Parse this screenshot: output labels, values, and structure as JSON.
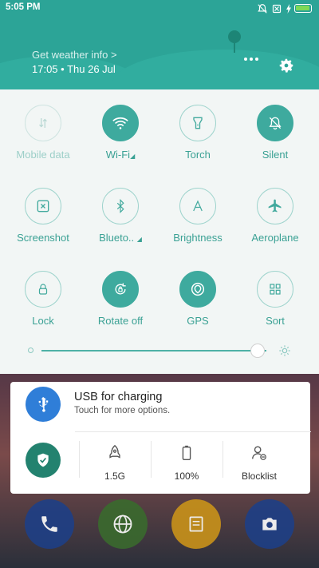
{
  "status_bar": {
    "time": "5:05 PM"
  },
  "header": {
    "weather_link": "Get weather info >",
    "datetime": "17:05 • Thu 26 Jul",
    "more_icon": "more-icon",
    "settings_icon": "gear-icon"
  },
  "tiles": [
    {
      "label": "Mobile data",
      "icon": "mobile-data-icon",
      "state": "off"
    },
    {
      "label": "Wi-Fi",
      "icon": "wifi-icon",
      "state": "on"
    },
    {
      "label": "Torch",
      "icon": "torch-icon",
      "state": "idle"
    },
    {
      "label": "Silent",
      "icon": "silent-bell-icon",
      "state": "on"
    },
    {
      "label": "Screenshot",
      "icon": "screenshot-icon",
      "state": "idle"
    },
    {
      "label": "Blueto..",
      "icon": "bluetooth-icon",
      "state": "idle"
    },
    {
      "label": "Brightness",
      "icon": "brightness-a-icon",
      "state": "idle"
    },
    {
      "label": "Aeroplane",
      "icon": "aeroplane-icon",
      "state": "idle"
    },
    {
      "label": "Lock",
      "icon": "lock-icon",
      "state": "idle"
    },
    {
      "label": "Rotate off",
      "icon": "rotate-lock-icon",
      "state": "on"
    },
    {
      "label": "GPS",
      "icon": "gps-icon",
      "state": "on"
    },
    {
      "label": "Sort",
      "icon": "grid-icon",
      "state": "idle"
    }
  ],
  "brightness_level": 0.96,
  "notification": {
    "title": "USB for charging",
    "subtitle": "Touch for more options."
  },
  "shortcuts": [
    {
      "label": "1.5G",
      "icon": "rocket-icon"
    },
    {
      "label": "100%",
      "icon": "battery-icon"
    },
    {
      "label": "Blocklist",
      "icon": "blocklist-icon"
    }
  ],
  "colors": {
    "teal": "#2ca497",
    "accent": "#3eaa9e",
    "usb_blue": "#2f7ed8",
    "shield_green": "#23826f"
  }
}
